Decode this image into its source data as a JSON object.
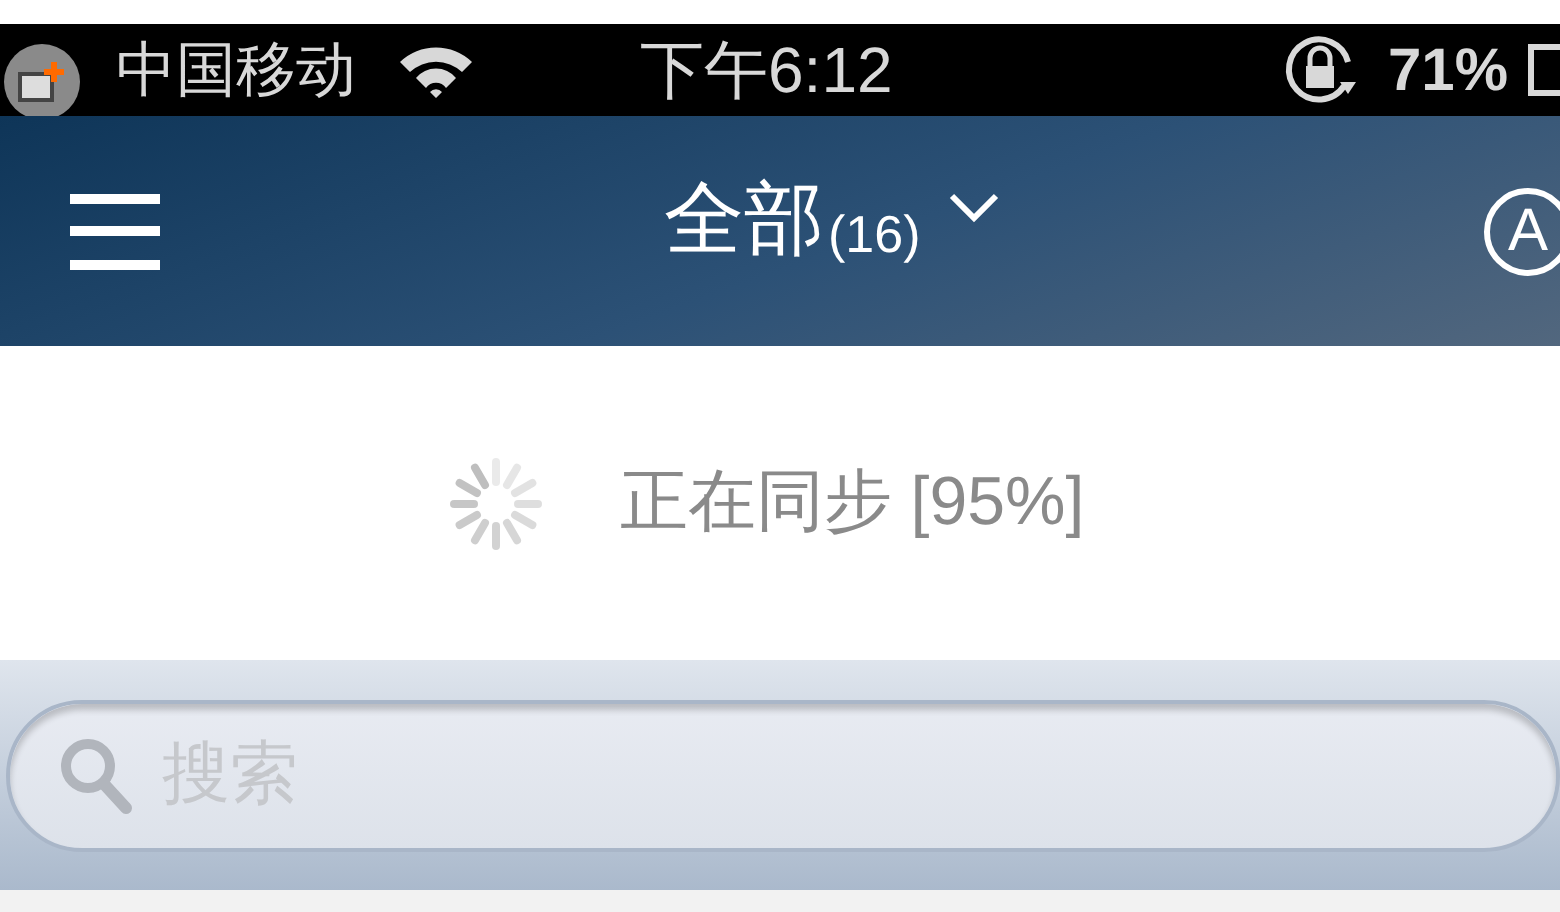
{
  "status_bar": {
    "carrier": "中国移动",
    "time": "下午6:12",
    "battery": "71%"
  },
  "header": {
    "title": "全部",
    "count": "(16)",
    "account_badge": "A"
  },
  "sync": {
    "text": "正在同步 [95%]"
  },
  "search": {
    "placeholder": "搜索"
  }
}
